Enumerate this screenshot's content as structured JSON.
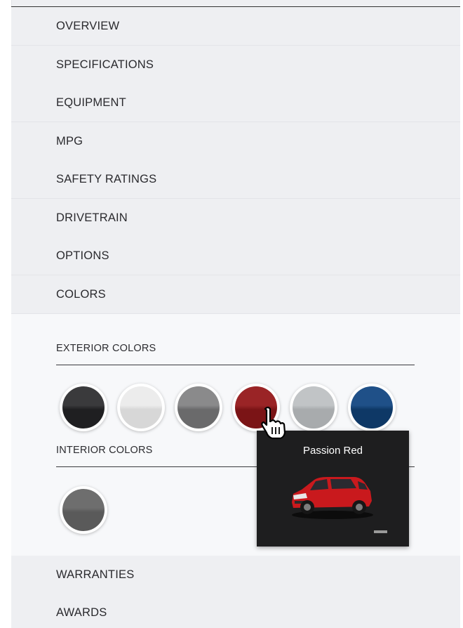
{
  "nav": {
    "overview": "OVERVIEW",
    "specifications": "SPECIFICATIONS",
    "equipment": "EQUIPMENT",
    "mpg": "MPG",
    "safety_ratings": "SAFETY RATINGS",
    "drivetrain": "DRIVETRAIN",
    "options": "OPTIONS",
    "colors": "COLORS",
    "warranties": "WARRANTIES",
    "awards": "AWARDS"
  },
  "colors": {
    "exterior_heading": "EXTERIOR COLORS",
    "interior_heading": "INTERIOR COLORS",
    "exterior_swatches": [
      {
        "color": "#1f1f21",
        "highlight": "#3a3a3c"
      },
      {
        "color": "#d7d7d7",
        "highlight": "#ececec"
      },
      {
        "color": "#6a6a6b",
        "highlight": "#8a8a8b"
      },
      {
        "color": "#7b1416",
        "highlight": "#9a2426"
      },
      {
        "color": "#a8abad",
        "highlight": "#c1c4c6"
      },
      {
        "color": "#0e3866",
        "highlight": "#1f5088"
      }
    ],
    "interior_swatches": [
      {
        "color": "#5a5a5a",
        "highlight": "#6e6e6e"
      }
    ]
  },
  "tooltip": {
    "title": "Passion Red",
    "image_icon": "car-image"
  },
  "cursor_icon": "hand-pointer-icon"
}
